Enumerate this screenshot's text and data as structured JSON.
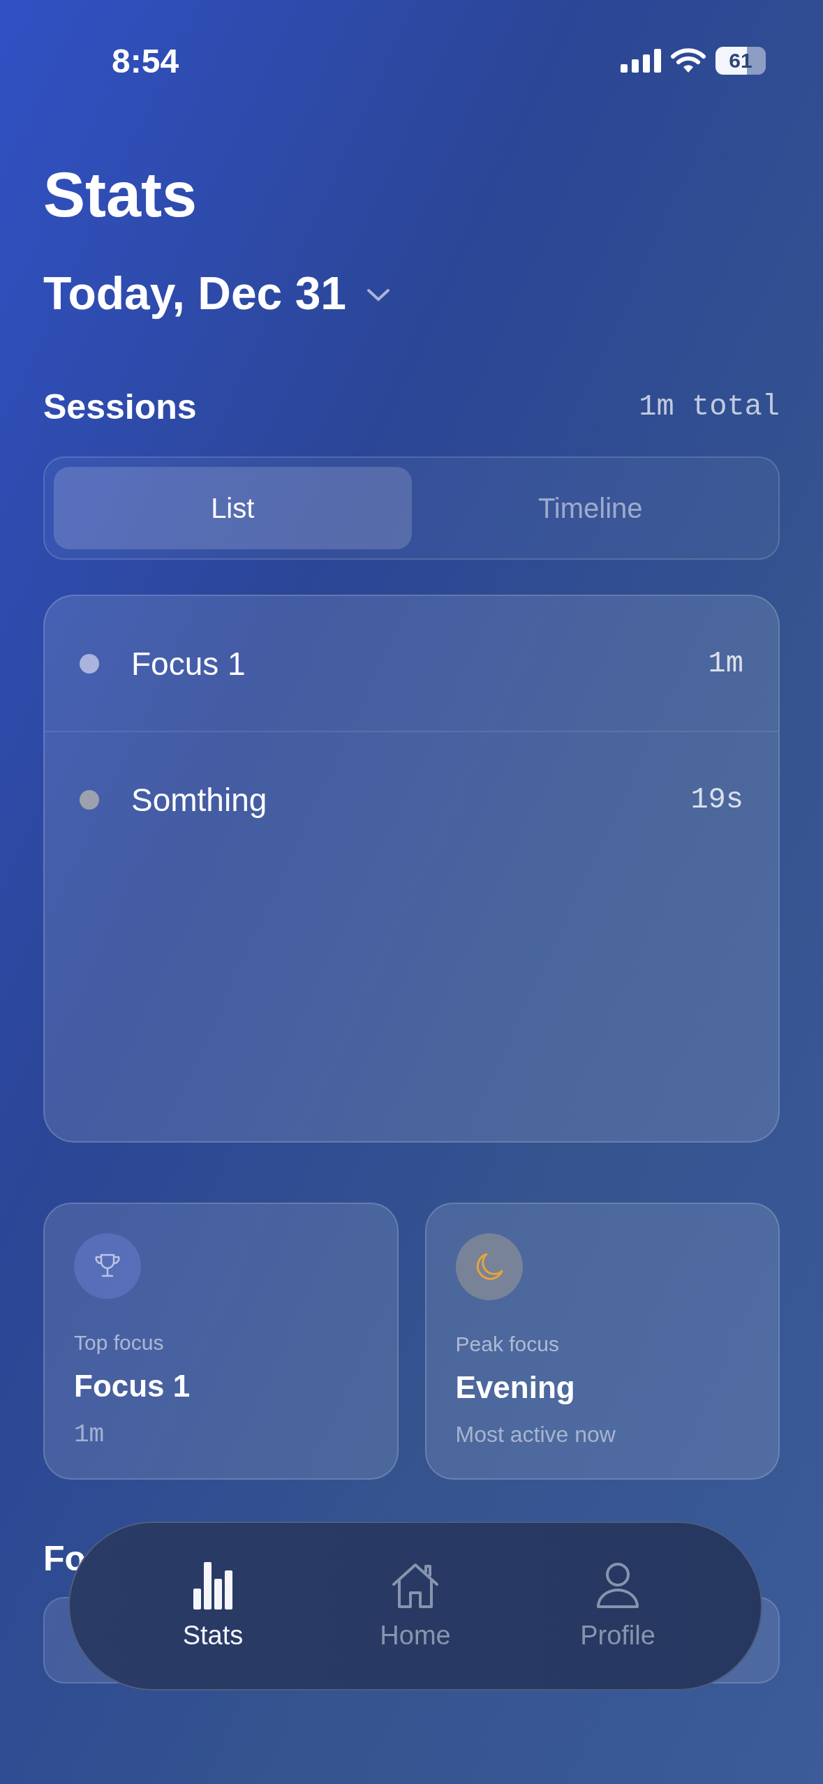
{
  "status_bar": {
    "time": "8:54",
    "battery": "61"
  },
  "title": "Stats",
  "date_picker": {
    "label": "Today, Dec 31"
  },
  "sessions": {
    "heading": "Sessions",
    "total": "1m total",
    "tabs": [
      {
        "label": "List",
        "selected": true
      },
      {
        "label": "Timeline",
        "selected": false
      }
    ],
    "items": [
      {
        "name": "Focus 1",
        "duration": "1m",
        "color": "#aab4dc"
      },
      {
        "name": "Somthing",
        "duration": "19s",
        "color": "#9ba2ad"
      }
    ]
  },
  "summary_cards": [
    {
      "label": "Top focus",
      "value": "Focus 1",
      "detail": "1m"
    },
    {
      "label": "Peak focus",
      "value": "Evening",
      "detail": "Most active now"
    }
  ],
  "next_section": {
    "heading": "Fo"
  },
  "tab_bar": [
    {
      "label": "Stats",
      "selected": true
    },
    {
      "label": "Home",
      "selected": false
    },
    {
      "label": "Profile",
      "selected": false
    }
  ]
}
